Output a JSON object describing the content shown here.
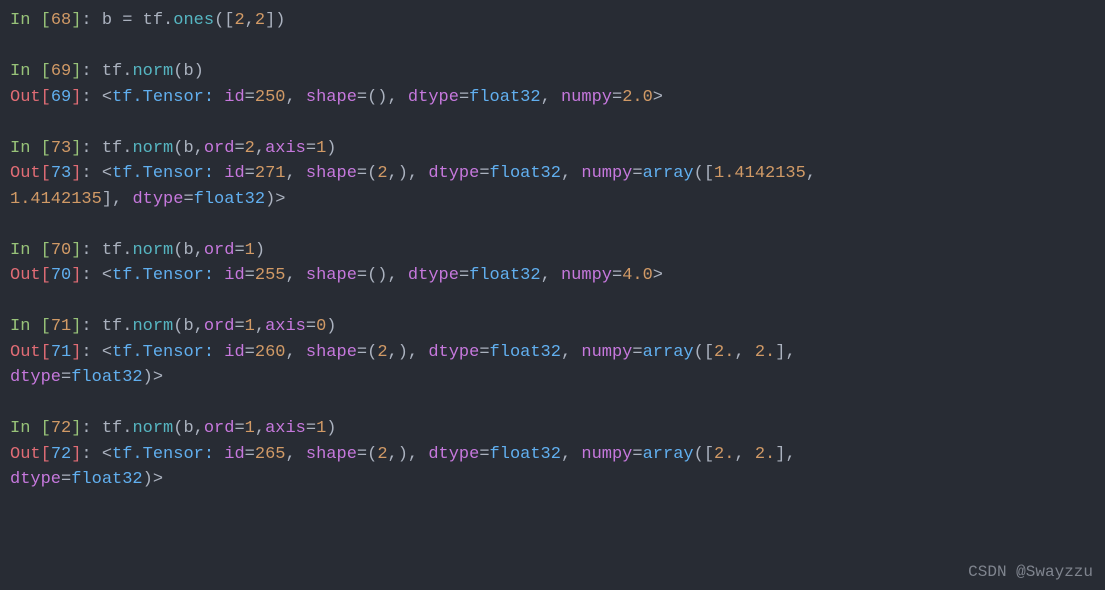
{
  "watermark": "CSDN @Swayzzu",
  "lines": [
    {
      "type": "in",
      "n": "68",
      "tokens": [
        {
          "t": "b ",
          "c": "c-default"
        },
        {
          "t": "=",
          "c": "c-default"
        },
        {
          "t": " tf",
          "c": "c-default"
        },
        {
          "t": ".",
          "c": "c-default"
        },
        {
          "t": "ones",
          "c": "c-call"
        },
        {
          "t": "(",
          "c": "c-br"
        },
        {
          "t": "[",
          "c": "c-br"
        },
        {
          "t": "2",
          "c": "c-num"
        },
        {
          "t": ",",
          "c": "c-default"
        },
        {
          "t": "2",
          "c": "c-num"
        },
        {
          "t": "]",
          "c": "c-br"
        },
        {
          "t": ")",
          "c": "c-br"
        }
      ]
    },
    {
      "type": "blank"
    },
    {
      "type": "in",
      "n": "69",
      "tokens": [
        {
          "t": "tf",
          "c": "c-default"
        },
        {
          "t": ".",
          "c": "c-default"
        },
        {
          "t": "norm",
          "c": "c-call"
        },
        {
          "t": "(",
          "c": "c-br"
        },
        {
          "t": "b",
          "c": "c-default"
        },
        {
          "t": ")",
          "c": "c-br"
        }
      ]
    },
    {
      "type": "out",
      "n": "69",
      "tokens": [
        {
          "t": "<",
          "c": "angle"
        },
        {
          "t": "tf.Tensor:",
          "c": "c-type"
        },
        {
          "t": " ",
          "c": "c-default"
        },
        {
          "t": "id",
          "c": "c-kw"
        },
        {
          "t": "=",
          "c": "c-default"
        },
        {
          "t": "250",
          "c": "c-num"
        },
        {
          "t": ", ",
          "c": "c-default"
        },
        {
          "t": "shape",
          "c": "c-kw"
        },
        {
          "t": "=",
          "c": "c-default"
        },
        {
          "t": "()",
          "c": "c-br"
        },
        {
          "t": ", ",
          "c": "c-default"
        },
        {
          "t": "dtype",
          "c": "c-kw"
        },
        {
          "t": "=",
          "c": "c-default"
        },
        {
          "t": "float32",
          "c": "c-type"
        },
        {
          "t": ", ",
          "c": "c-default"
        },
        {
          "t": "numpy",
          "c": "c-kw"
        },
        {
          "t": "=",
          "c": "c-default"
        },
        {
          "t": "2.0",
          "c": "c-num"
        },
        {
          "t": ">",
          "c": "angle"
        }
      ]
    },
    {
      "type": "blank"
    },
    {
      "type": "in",
      "n": "73",
      "tokens": [
        {
          "t": "tf",
          "c": "c-default"
        },
        {
          "t": ".",
          "c": "c-default"
        },
        {
          "t": "norm",
          "c": "c-call"
        },
        {
          "t": "(",
          "c": "c-br"
        },
        {
          "t": "b",
          "c": "c-default"
        },
        {
          "t": ",",
          "c": "c-default"
        },
        {
          "t": "ord",
          "c": "c-kw"
        },
        {
          "t": "=",
          "c": "c-default"
        },
        {
          "t": "2",
          "c": "c-num"
        },
        {
          "t": ",",
          "c": "c-default"
        },
        {
          "t": "axis",
          "c": "c-kw"
        },
        {
          "t": "=",
          "c": "c-default"
        },
        {
          "t": "1",
          "c": "c-num"
        },
        {
          "t": ")",
          "c": "c-br"
        }
      ]
    },
    {
      "type": "out",
      "n": "73",
      "tokens": [
        {
          "t": "<",
          "c": "angle"
        },
        {
          "t": "tf.Tensor:",
          "c": "c-type"
        },
        {
          "t": " ",
          "c": "c-default"
        },
        {
          "t": "id",
          "c": "c-kw"
        },
        {
          "t": "=",
          "c": "c-default"
        },
        {
          "t": "271",
          "c": "c-num"
        },
        {
          "t": ", ",
          "c": "c-default"
        },
        {
          "t": "shape",
          "c": "c-kw"
        },
        {
          "t": "=",
          "c": "c-default"
        },
        {
          "t": "(",
          "c": "c-br"
        },
        {
          "t": "2",
          "c": "c-num"
        },
        {
          "t": ",)",
          "c": "c-br"
        },
        {
          "t": ", ",
          "c": "c-default"
        },
        {
          "t": "dtype",
          "c": "c-kw"
        },
        {
          "t": "=",
          "c": "c-default"
        },
        {
          "t": "float32",
          "c": "c-type"
        },
        {
          "t": ", ",
          "c": "c-default"
        },
        {
          "t": "numpy",
          "c": "c-kw"
        },
        {
          "t": "=",
          "c": "c-default"
        },
        {
          "t": "array",
          "c": "c-type"
        },
        {
          "t": "(",
          "c": "c-br"
        },
        {
          "t": "[",
          "c": "c-br"
        },
        {
          "t": "1.4142135",
          "c": "c-num"
        },
        {
          "t": ", ",
          "c": "c-default"
        }
      ]
    },
    {
      "type": "cont",
      "tokens": [
        {
          "t": "1.4142135",
          "c": "c-num"
        },
        {
          "t": "]",
          "c": "c-br"
        },
        {
          "t": ", ",
          "c": "c-default"
        },
        {
          "t": "dtype",
          "c": "c-kw"
        },
        {
          "t": "=",
          "c": "c-default"
        },
        {
          "t": "float32",
          "c": "c-type"
        },
        {
          "t": ")",
          "c": "c-br"
        },
        {
          "t": ">",
          "c": "angle"
        }
      ]
    },
    {
      "type": "blank"
    },
    {
      "type": "in",
      "n": "70",
      "tokens": [
        {
          "t": "tf",
          "c": "c-default"
        },
        {
          "t": ".",
          "c": "c-default"
        },
        {
          "t": "norm",
          "c": "c-call"
        },
        {
          "t": "(",
          "c": "c-br"
        },
        {
          "t": "b",
          "c": "c-default"
        },
        {
          "t": ",",
          "c": "c-default"
        },
        {
          "t": "ord",
          "c": "c-kw"
        },
        {
          "t": "=",
          "c": "c-default"
        },
        {
          "t": "1",
          "c": "c-num"
        },
        {
          "t": ")",
          "c": "c-br"
        }
      ]
    },
    {
      "type": "out",
      "n": "70",
      "tokens": [
        {
          "t": "<",
          "c": "angle"
        },
        {
          "t": "tf.Tensor:",
          "c": "c-type"
        },
        {
          "t": " ",
          "c": "c-default"
        },
        {
          "t": "id",
          "c": "c-kw"
        },
        {
          "t": "=",
          "c": "c-default"
        },
        {
          "t": "255",
          "c": "c-num"
        },
        {
          "t": ", ",
          "c": "c-default"
        },
        {
          "t": "shape",
          "c": "c-kw"
        },
        {
          "t": "=",
          "c": "c-default"
        },
        {
          "t": "()",
          "c": "c-br"
        },
        {
          "t": ", ",
          "c": "c-default"
        },
        {
          "t": "dtype",
          "c": "c-kw"
        },
        {
          "t": "=",
          "c": "c-default"
        },
        {
          "t": "float32",
          "c": "c-type"
        },
        {
          "t": ", ",
          "c": "c-default"
        },
        {
          "t": "numpy",
          "c": "c-kw"
        },
        {
          "t": "=",
          "c": "c-default"
        },
        {
          "t": "4.0",
          "c": "c-num"
        },
        {
          "t": ">",
          "c": "angle"
        }
      ]
    },
    {
      "type": "blank"
    },
    {
      "type": "in",
      "n": "71",
      "tokens": [
        {
          "t": "tf",
          "c": "c-default"
        },
        {
          "t": ".",
          "c": "c-default"
        },
        {
          "t": "norm",
          "c": "c-call"
        },
        {
          "t": "(",
          "c": "c-br"
        },
        {
          "t": "b",
          "c": "c-default"
        },
        {
          "t": ",",
          "c": "c-default"
        },
        {
          "t": "ord",
          "c": "c-kw"
        },
        {
          "t": "=",
          "c": "c-default"
        },
        {
          "t": "1",
          "c": "c-num"
        },
        {
          "t": ",",
          "c": "c-default"
        },
        {
          "t": "axis",
          "c": "c-kw"
        },
        {
          "t": "=",
          "c": "c-default"
        },
        {
          "t": "0",
          "c": "c-num"
        },
        {
          "t": ")",
          "c": "c-br"
        }
      ]
    },
    {
      "type": "out",
      "n": "71",
      "tokens": [
        {
          "t": "<",
          "c": "angle"
        },
        {
          "t": "tf.Tensor:",
          "c": "c-type"
        },
        {
          "t": " ",
          "c": "c-default"
        },
        {
          "t": "id",
          "c": "c-kw"
        },
        {
          "t": "=",
          "c": "c-default"
        },
        {
          "t": "260",
          "c": "c-num"
        },
        {
          "t": ", ",
          "c": "c-default"
        },
        {
          "t": "shape",
          "c": "c-kw"
        },
        {
          "t": "=",
          "c": "c-default"
        },
        {
          "t": "(",
          "c": "c-br"
        },
        {
          "t": "2",
          "c": "c-num"
        },
        {
          "t": ",)",
          "c": "c-br"
        },
        {
          "t": ", ",
          "c": "c-default"
        },
        {
          "t": "dtype",
          "c": "c-kw"
        },
        {
          "t": "=",
          "c": "c-default"
        },
        {
          "t": "float32",
          "c": "c-type"
        },
        {
          "t": ", ",
          "c": "c-default"
        },
        {
          "t": "numpy",
          "c": "c-kw"
        },
        {
          "t": "=",
          "c": "c-default"
        },
        {
          "t": "array",
          "c": "c-type"
        },
        {
          "t": "(",
          "c": "c-br"
        },
        {
          "t": "[",
          "c": "c-br"
        },
        {
          "t": "2.",
          "c": "c-num"
        },
        {
          "t": ", ",
          "c": "c-default"
        },
        {
          "t": "2.",
          "c": "c-num"
        },
        {
          "t": "]",
          "c": "c-br"
        },
        {
          "t": ", ",
          "c": "c-default"
        }
      ]
    },
    {
      "type": "cont",
      "tokens": [
        {
          "t": "dtype",
          "c": "c-kw"
        },
        {
          "t": "=",
          "c": "c-default"
        },
        {
          "t": "float32",
          "c": "c-type"
        },
        {
          "t": ")",
          "c": "c-br"
        },
        {
          "t": ">",
          "c": "angle"
        }
      ]
    },
    {
      "type": "blank"
    },
    {
      "type": "in",
      "n": "72",
      "tokens": [
        {
          "t": "tf",
          "c": "c-default"
        },
        {
          "t": ".",
          "c": "c-default"
        },
        {
          "t": "norm",
          "c": "c-call"
        },
        {
          "t": "(",
          "c": "c-br"
        },
        {
          "t": "b",
          "c": "c-default"
        },
        {
          "t": ",",
          "c": "c-default"
        },
        {
          "t": "ord",
          "c": "c-kw"
        },
        {
          "t": "=",
          "c": "c-default"
        },
        {
          "t": "1",
          "c": "c-num"
        },
        {
          "t": ",",
          "c": "c-default"
        },
        {
          "t": "axis",
          "c": "c-kw"
        },
        {
          "t": "=",
          "c": "c-default"
        },
        {
          "t": "1",
          "c": "c-num"
        },
        {
          "t": ")",
          "c": "c-br"
        }
      ]
    },
    {
      "type": "out",
      "n": "72",
      "tokens": [
        {
          "t": "<",
          "c": "angle"
        },
        {
          "t": "tf.Tensor:",
          "c": "c-type"
        },
        {
          "t": " ",
          "c": "c-default"
        },
        {
          "t": "id",
          "c": "c-kw"
        },
        {
          "t": "=",
          "c": "c-default"
        },
        {
          "t": "265",
          "c": "c-num"
        },
        {
          "t": ", ",
          "c": "c-default"
        },
        {
          "t": "shape",
          "c": "c-kw"
        },
        {
          "t": "=",
          "c": "c-default"
        },
        {
          "t": "(",
          "c": "c-br"
        },
        {
          "t": "2",
          "c": "c-num"
        },
        {
          "t": ",)",
          "c": "c-br"
        },
        {
          "t": ", ",
          "c": "c-default"
        },
        {
          "t": "dtype",
          "c": "c-kw"
        },
        {
          "t": "=",
          "c": "c-default"
        },
        {
          "t": "float32",
          "c": "c-type"
        },
        {
          "t": ", ",
          "c": "c-default"
        },
        {
          "t": "numpy",
          "c": "c-kw"
        },
        {
          "t": "=",
          "c": "c-default"
        },
        {
          "t": "array",
          "c": "c-type"
        },
        {
          "t": "(",
          "c": "c-br"
        },
        {
          "t": "[",
          "c": "c-br"
        },
        {
          "t": "2.",
          "c": "c-num"
        },
        {
          "t": ", ",
          "c": "c-default"
        },
        {
          "t": "2.",
          "c": "c-num"
        },
        {
          "t": "]",
          "c": "c-br"
        },
        {
          "t": ", ",
          "c": "c-default"
        }
      ]
    },
    {
      "type": "cont",
      "tokens": [
        {
          "t": "dtype",
          "c": "c-kw"
        },
        {
          "t": "=",
          "c": "c-default"
        },
        {
          "t": "float32",
          "c": "c-type"
        },
        {
          "t": ")",
          "c": "c-br"
        },
        {
          "t": ">",
          "c": "angle"
        }
      ]
    }
  ]
}
